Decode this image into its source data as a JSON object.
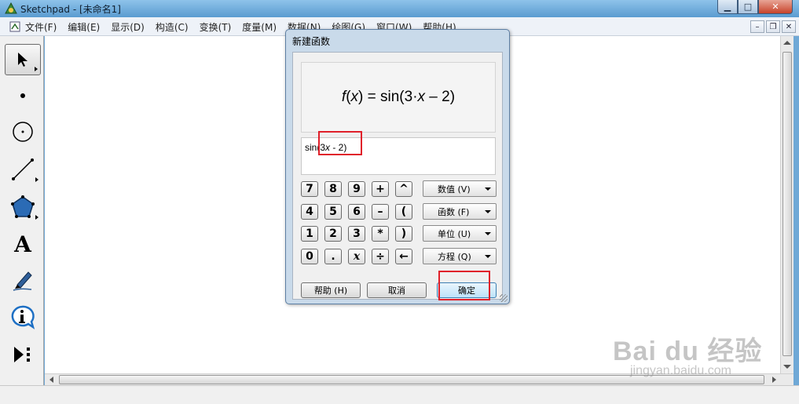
{
  "window": {
    "title": "Sketchpad - [未命名1]",
    "controls": {
      "minimize": "▁",
      "maximize": "□",
      "close": "✕"
    }
  },
  "menu": {
    "items": [
      "文件(F)",
      "编辑(E)",
      "显示(D)",
      "构造(C)",
      "变换(T)",
      "度量(M)",
      "数据(N)",
      "绘图(G)",
      "窗口(W)",
      "帮助(H)"
    ],
    "mdi_controls": {
      "minimize": "–",
      "restore": "❐",
      "close": "✕"
    }
  },
  "toolbox": {
    "tools": [
      {
        "name": "arrow-tool",
        "icon": "arrow-icon"
      },
      {
        "name": "point-tool",
        "icon": "point-icon"
      },
      {
        "name": "compass-tool",
        "icon": "circle-icon"
      },
      {
        "name": "straightedge-tool",
        "icon": "line-icon"
      },
      {
        "name": "polygon-tool",
        "icon": "pentagon-icon"
      },
      {
        "name": "text-tool",
        "icon": "text-icon",
        "label": "A"
      },
      {
        "name": "marker-tool",
        "icon": "pen-icon"
      },
      {
        "name": "info-tool",
        "icon": "info-icon"
      },
      {
        "name": "custom-tool",
        "icon": "play-dots-icon"
      }
    ]
  },
  "dialog": {
    "title": "新建函数",
    "preview": {
      "func": "f",
      "var": "x",
      "rest_a": ") = sin(3·",
      "rest_b": " – 2)"
    },
    "expression": {
      "prefix": "sin(3",
      "var": "x",
      "suffix": " - 2)"
    },
    "keypad": {
      "row1": [
        "7",
        "8",
        "9",
        "+",
        "^"
      ],
      "row2": [
        "4",
        "5",
        "6",
        "–",
        "("
      ],
      "row3": [
        "1",
        "2",
        "3",
        "*",
        ")"
      ],
      "row4": [
        "0",
        ".",
        "x",
        "÷",
        "←"
      ]
    },
    "dropdowns": [
      "数值 (V)",
      "函数 (F)",
      "单位 (U)",
      "方程 (Q)"
    ],
    "buttons": {
      "help": "帮助 (H)",
      "cancel": "取消",
      "ok": "确定"
    }
  },
  "watermark": {
    "brand": "Bai du 经验",
    "site": "jingyan.baidu.com"
  },
  "colors": {
    "highlight": "#e0202a",
    "titlebar": "#6fa8d6"
  }
}
